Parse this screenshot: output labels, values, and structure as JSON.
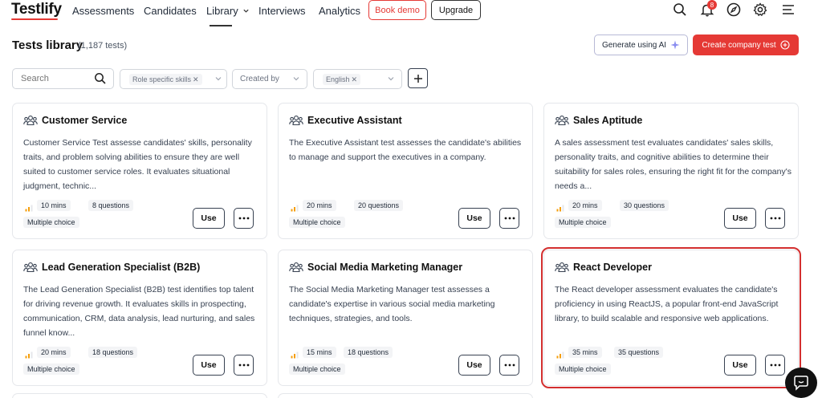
{
  "nav": {
    "logo": "Testlify",
    "items": [
      "Assessments",
      "Candidates",
      "Library",
      "Interviews",
      "Analytics"
    ],
    "book_demo": "Book demo",
    "upgrade": "Upgrade",
    "notification_count": "8"
  },
  "header": {
    "title": "Tests library",
    "count": "(1,187 tests)",
    "generate_ai": "Generate using AI",
    "create_test": "Create company test"
  },
  "filters": {
    "search_placeholder": "Search",
    "skill_chip": "Role specific skills",
    "created_by": "Created by",
    "language_chip": "English"
  },
  "cards": [
    {
      "title": "Customer Service",
      "description": "Customer Service Test assesse candidates' skills, personality traits, and problem solving abilities to ensure they are well suited to customer service roles. It evaluates situational judgment, technic...",
      "duration": "10 mins",
      "questions": "8 questions",
      "type": "Multiple choice"
    },
    {
      "title": "Executive Assistant",
      "description": "The Executive Assistant test assesses the candidate's abilities to manage and support the executives in a company.",
      "duration": "20 mins",
      "questions": "20 questions",
      "type": "Multiple choice"
    },
    {
      "title": "Sales Aptitude",
      "description": "A sales assessment test evaluates candidates' sales skills, personality traits, and cognitive abilities to determine their suitability for sales roles, ensuring the right fit for the company's needs a...",
      "duration": "20 mins",
      "questions": "30 questions",
      "type": "Multiple choice"
    },
    {
      "title": "Lead Generation Specialist (B2B)",
      "description": "The Lead Generation Specialist (B2B) test identifies top talent for driving revenue growth. It evaluates skills in prospecting, communication, CRM, data analysis, lead nurturing, and sales funnel know...",
      "duration": "20 mins",
      "questions": "18 questions",
      "type": "Multiple choice"
    },
    {
      "title": "Social Media Marketing Manager",
      "description": "The Social Media Marketing Manager test assesses a candidate's expertise in various social media marketing techniques, strategies, and tools.",
      "duration": "15 mins",
      "questions": "18 questions",
      "type": "Multiple choice"
    },
    {
      "title": "React Developer",
      "description": "The React developer assessment evaluates the candidate's proficiency in using ReactJS, a popular front-end JavaScript library, to build scalable and responsive web applications.",
      "duration": "35 mins",
      "questions": "35 questions",
      "type": "Multiple choice"
    }
  ],
  "card_actions": {
    "use": "Use"
  },
  "colors": {
    "brand_red": "#e53935",
    "highlight": "#d32f2f"
  },
  "icons": [
    "search-icon",
    "bell-icon",
    "compass-icon",
    "gear-icon",
    "menu-icon",
    "sparkle-icon",
    "plus-circle-icon",
    "team-icon",
    "chat-icon"
  ]
}
